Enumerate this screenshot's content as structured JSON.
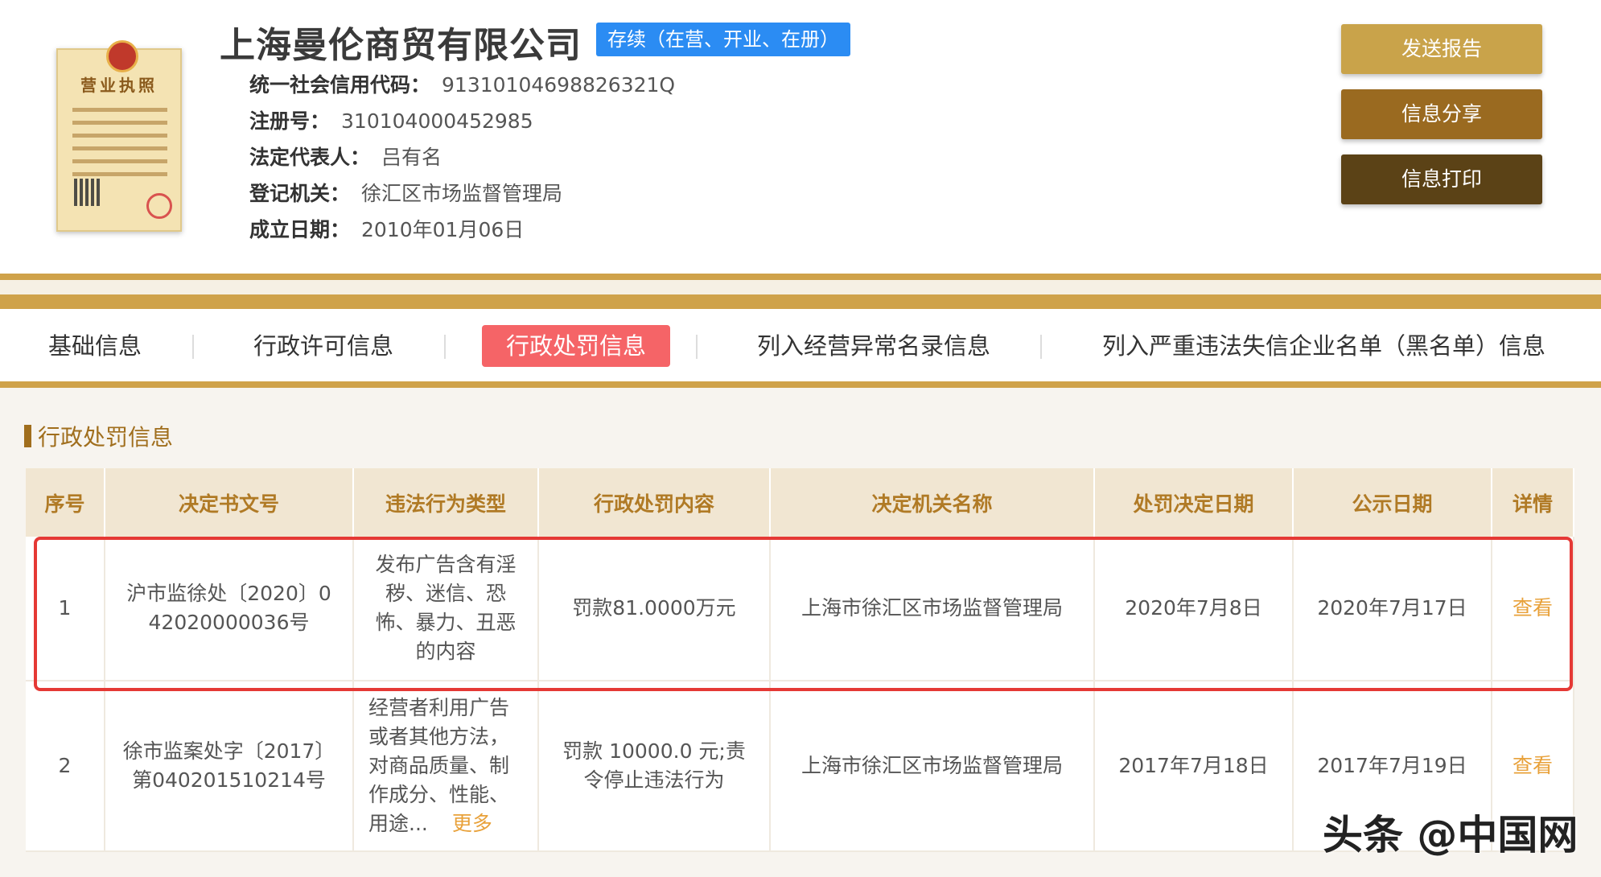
{
  "company": {
    "name": "上海曼伦商贸有限公司",
    "status": "存续（在营、开业、在册）",
    "fields": [
      {
        "label": "统一社会信用代码：",
        "value": "91310104698826321Q"
      },
      {
        "label": "注册号：",
        "value": "310104000452985"
      },
      {
        "label": "法定代表人：",
        "value": "吕有名"
      },
      {
        "label": "登记机关：",
        "value": "徐汇区市场监督管理局"
      },
      {
        "label": "成立日期：",
        "value": "2010年01月06日"
      }
    ],
    "license_title": "营业执照"
  },
  "actions": {
    "send": "发送报告",
    "share": "信息分享",
    "print": "信息打印"
  },
  "tabs": [
    {
      "label": "基础信息",
      "active": false
    },
    {
      "label": "行政许可信息",
      "active": false
    },
    {
      "label": "行政处罚信息",
      "active": true
    },
    {
      "label": "列入经营异常名录信息",
      "active": false
    },
    {
      "label": "列入严重违法失信企业名单（黑名单）信息",
      "active": false
    }
  ],
  "section": {
    "title": "行政处罚信息"
  },
  "table": {
    "headers": [
      "序号",
      "决定书文号",
      "违法行为类型",
      "行政处罚内容",
      "决定机关名称",
      "处罚决定日期",
      "公示日期",
      "详情"
    ],
    "rows": [
      {
        "index": "1",
        "doc_no": "沪市监徐处〔2020〕0\n42020000036号",
        "type": "发布广告含有淫秽、迷信、恐怖、暴力、丑恶的内容",
        "content": "罚款81.0000万元",
        "authority": "上海市徐汇区市场监督管理局",
        "decision_date": "2020年7月8日",
        "publish_date": "2020年7月17日",
        "detail": "查看"
      },
      {
        "index": "2",
        "doc_no": "徐市监案处字〔2017〕\n第040201510214号",
        "type": "经营者利用广告或者其他方法，对商品质量、制作成分、性能、用途...",
        "more": "更多",
        "content": "罚款 10000.0 元;责令停止违法行为",
        "authority": "上海市徐汇区市场监督管理局",
        "decision_date": "2017年7月18日",
        "publish_date": "2017年7月19日",
        "detail": "查看"
      }
    ]
  },
  "watermark": "头条 @中国网",
  "colors": {
    "gold": "#cfa24a",
    "status_blue": "#2b8cf3",
    "active_tab": "#f56467",
    "highlight": "#e53935",
    "link": "#e8a13a"
  }
}
